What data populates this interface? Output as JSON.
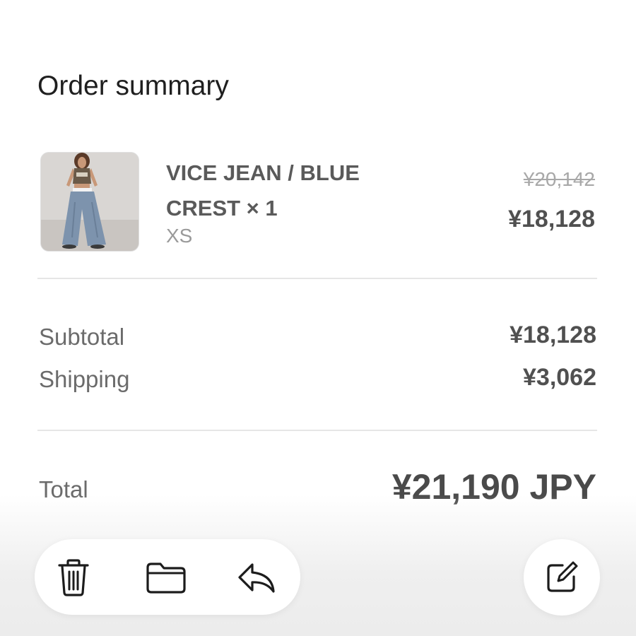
{
  "header": {
    "title": "Order summary"
  },
  "line_item": {
    "name": "VICE JEAN / BLUE CREST × 1",
    "variant": "XS",
    "original_price": "¥20,142",
    "sale_price": "¥18,128",
    "image_alt": "product-photo"
  },
  "summary": {
    "subtotal_label": "Subtotal",
    "subtotal_value": "¥18,128",
    "shipping_label": "Shipping",
    "shipping_value": "¥3,062",
    "total_label": "Total",
    "total_value": "¥21,190 JPY"
  },
  "toolbar": {
    "icons": [
      "trash-icon",
      "folder-icon",
      "reply-icon"
    ],
    "compose_icon": "compose-icon"
  },
  "colors": {
    "text_primary": "#1f1f1f",
    "text_secondary": "#6b6b6b",
    "text_muted": "#9a9a9a",
    "divider": "#e6e6e6"
  }
}
